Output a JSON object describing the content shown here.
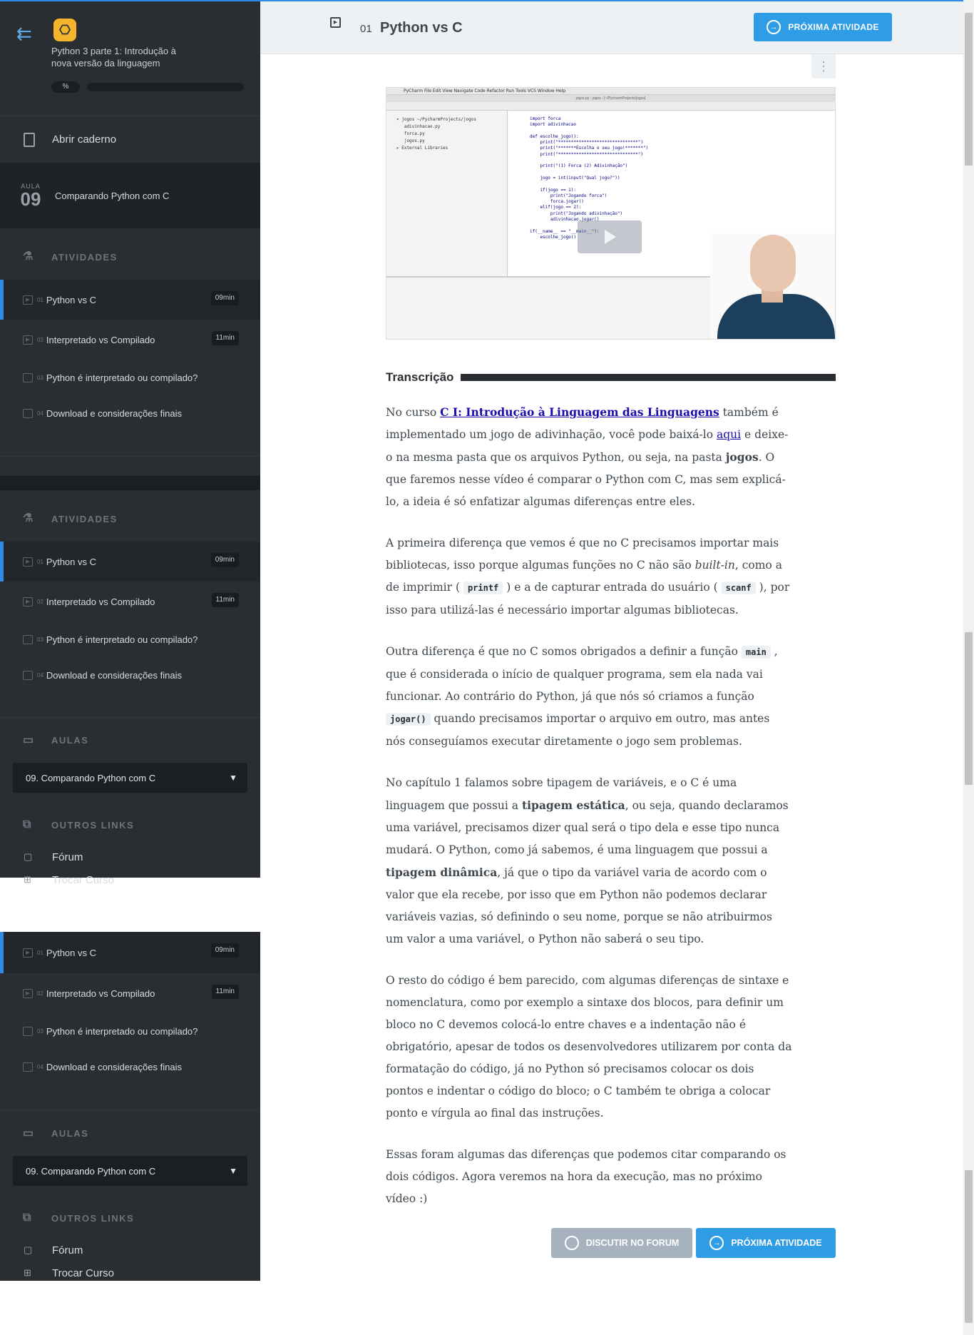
{
  "course": {
    "title": "Python 3 parte 1: Introdução à nova versão da linguagem",
    "progress": "%",
    "notebook": "Abrir caderno",
    "lesson_label": "AULA",
    "lesson_number": "09",
    "lesson_title": "Comparando Python com C"
  },
  "sidebar": {
    "activities_title": "ATIVIDADES",
    "activities": [
      {
        "num": "01",
        "label": "Python vs C",
        "duration": "09min",
        "type": "video"
      },
      {
        "num": "02",
        "label": "Interpretado vs Compilado",
        "duration": "11min",
        "type": "video"
      },
      {
        "num": "03",
        "label": "Python é interpretado ou compilado?",
        "duration": "",
        "type": "read"
      },
      {
        "num": "04",
        "label": "Download e considerações finais",
        "duration": "",
        "type": "read"
      }
    ],
    "aulas_title": "AULAS",
    "aulas_selected": "09. Comparando Python com C",
    "links_title": "OUTROS LINKS",
    "links": [
      "Fórum",
      "Trocar Curso"
    ]
  },
  "header": {
    "num": "01",
    "title": "Python vs C",
    "next_button": "PRÓXIMA ATIVIDADE"
  },
  "video": {
    "menu": "PyCharm   File   Edit   View   Navigate   Code   Refactor   Run   Tools   VCS   Window   Help",
    "window_title": "jogos.py - jogos - [~/PycharmProjects/jogos]",
    "tree": "▾ jogos ~/PycharmProjects/jogos\n   adivinhacao.py\n   forca.py\n   jogos.py\n▸ External Libraries",
    "code": "import forca\nimport adivinhacao\n\ndef escolhe_jogo():\n    print(\"*******************************\")\n    print(\"*******Escolha o seu jogo!*******\")\n    print(\"*******************************\")\n\n    print(\"(1) Forca (2) Adivinhação\")\n\n    jogo = int(input(\"Qual jogo?\"))\n\n    if(jogo == 1):\n        print(\"Jogando forca\")\n        forca.jogar()\n    elif(jogo == 2):\n        print(\"Jogando adivinhação\")\n        adivinhacao.jogar()\n\nif(__name__ == \"__main__\"):\n    escolhe_jogo()"
  },
  "transcript": {
    "title": "Transcrição",
    "p1_a": "No curso ",
    "p1_link": "C I: Introdução à Linguagem das Linguagens",
    "p1_b": " também é implementado um jogo de adivinhação, você pode baixá-lo ",
    "p1_link2": "aqui",
    "p1_c": " e deixe-o na mesma pasta que os arquivos Python, ou seja, na pasta ",
    "p1_bold": "jogos",
    "p1_d": ". O que faremos nesse vídeo é comparar o Python com C, mas sem explicá-lo, a ideia é só enfatizar algumas diferenças entre eles.",
    "p2_a": "A primeira diferença que vemos é que no C precisamos importar mais bibliotecas, isso porque algumas funções no C não são ",
    "p2_em": "built-in",
    "p2_b": ", como a de imprimir ( ",
    "p2_code1": "printf",
    "p2_c": " ) e a de capturar entrada do usuário ( ",
    "p2_code2": "scanf",
    "p2_d": " ), por isso para utilizá-las é necessário importar algumas bibliotecas.",
    "p3_a": "Outra diferença é que no C somos obrigados a definir a função ",
    "p3_code1": "main",
    "p3_b": " , que é considerada o início de qualquer programa, sem ela nada vai funcionar. Ao contrário do Python, já que nós só criamos a função ",
    "p3_code2": "jogar()",
    "p3_c": " quando precisamos importar o arquivo em outro, mas antes nós conseguíamos executar diretamente o jogo sem problemas.",
    "p4_a": "No capítulo 1 falamos sobre tipagem de variáveis, e o C é uma linguagem que possui a ",
    "p4_bold1": "tipagem estática",
    "p4_b": ", ou seja, quando declaramos uma variável, precisamos dizer qual será o tipo dela e esse tipo nunca mudará. O Python, como já sabemos, é uma linguagem que possui a ",
    "p4_bold2": "tipagem dinâmica",
    "p4_c": ", já que o tipo da variável varia de acordo com o valor que ela recebe, por isso que em Python não podemos declarar variáveis vazias, só definindo o seu nome, porque se não atribuirmos um valor a uma variável, o Python não saberá o seu tipo.",
    "p5": "O resto do código é bem parecido, com algumas diferenças de sintaxe e nomenclatura, como por exemplo a sintaxe dos blocos, para definir um bloco no C devemos colocá-lo entre chaves e a indentação não é obrigatório, apesar de todos os desenvolvedores utilizarem por conta da formatação do código, já no Python só precisamos colocar os dois pontos e indentar o código do bloco; o C também te obriga a colocar ponto e vírgula ao final das instruções.",
    "p6": "Essas foram algumas das diferenças que podemos citar comparando os dois códigos. Agora veremos na hora da execução, mas no próximo vídeo :)"
  },
  "footer": {
    "forum_button": "DISCUTIR NO FORUM",
    "next_button": "PRÓXIMA ATIVIDADE"
  },
  "colors": {
    "sidebar_bg": "#2a2e33",
    "accent": "#2f9ce6",
    "logo": "#f4b52c"
  }
}
